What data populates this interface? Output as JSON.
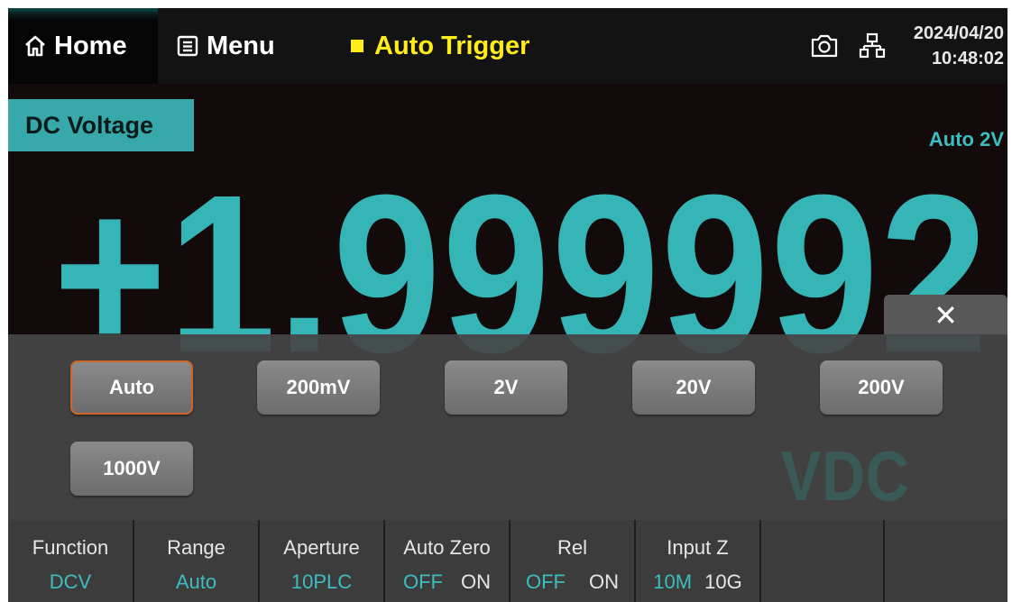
{
  "topbar": {
    "home_label": "Home",
    "menu_label": "Menu",
    "trigger_label": "Auto Trigger",
    "icons": {
      "home": "home-icon",
      "menu": "menu-icon",
      "camera": "camera-icon",
      "network": "network-icon"
    },
    "date": "2024/04/20",
    "time": "10:48:02"
  },
  "measurement": {
    "function_label": "DC Voltage",
    "range_indicator": "Auto 2V",
    "reading": "+1.999992",
    "unit": "VDC"
  },
  "range_popup": {
    "close_glyph": "✕",
    "selected": "Auto",
    "options": [
      "Auto",
      "200mV",
      "2V",
      "20V",
      "200V",
      "1000V"
    ]
  },
  "softkeys": [
    {
      "label": "Function",
      "value": "DCV"
    },
    {
      "label": "Range",
      "value": "Auto"
    },
    {
      "label": "Aperture",
      "value": "10PLC"
    },
    {
      "label": "Auto Zero",
      "option_a": "OFF",
      "option_b": "ON",
      "active": "OFF"
    },
    {
      "label": "Rel",
      "option_a": "OFF",
      "option_b": "ON",
      "active": "OFF"
    },
    {
      "label": "Input Z",
      "option_a": "10M",
      "option_b": "10G",
      "active": "10M"
    },
    {
      "label": ""
    },
    {
      "label": ""
    }
  ],
  "colors": {
    "accent_teal": "#38a9aa",
    "trigger_yellow": "#ffec1a",
    "selected_border": "#d0652a"
  }
}
